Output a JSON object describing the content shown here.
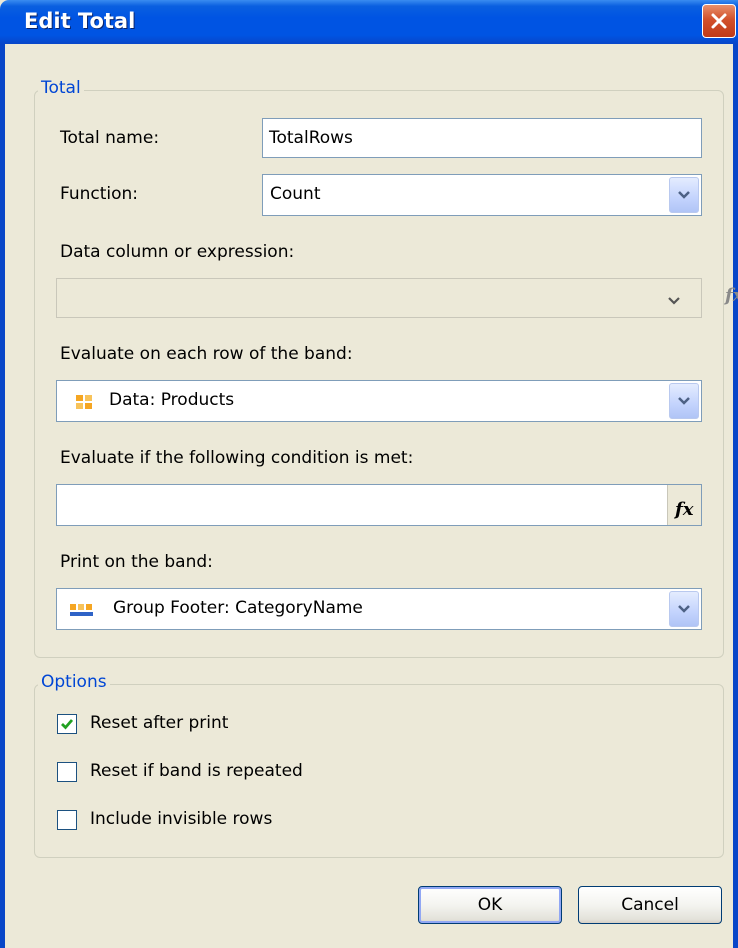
{
  "window": {
    "title": "Edit Total"
  },
  "total_group": {
    "label": "Total",
    "total_name_label": "Total name:",
    "total_name_value": "TotalRows",
    "function_label": "Function:",
    "function_value": "Count",
    "data_column_label": "Data column or expression:",
    "data_column_value": "",
    "evaluate_band_label": "Evaluate on each row of the band:",
    "evaluate_band_value": "Data: Products",
    "condition_label": "Evaluate if the following condition is met:",
    "condition_value": "",
    "print_band_label": "Print on the band:",
    "print_band_value": "Group Footer: CategoryName"
  },
  "options_group": {
    "label": "Options",
    "reset_after_print": {
      "label": "Reset after print",
      "checked": true
    },
    "reset_if_repeated": {
      "label": "Reset if band is repeated",
      "checked": false
    },
    "include_invisible": {
      "label": "Include invisible rows",
      "checked": false
    }
  },
  "buttons": {
    "ok": "OK",
    "cancel": "Cancel"
  },
  "icons": {
    "close": "close-icon",
    "dropdown": "chevron-down-icon",
    "fx": "fx-icon",
    "data_band": "data-band-icon",
    "group_footer_band": "group-footer-band-icon",
    "check": "checkmark-icon"
  },
  "colors": {
    "title_bar": "#0054e3",
    "group_label": "#0046d5",
    "dialog_bg": "#ece9d8",
    "close_button": "#d2512c"
  }
}
